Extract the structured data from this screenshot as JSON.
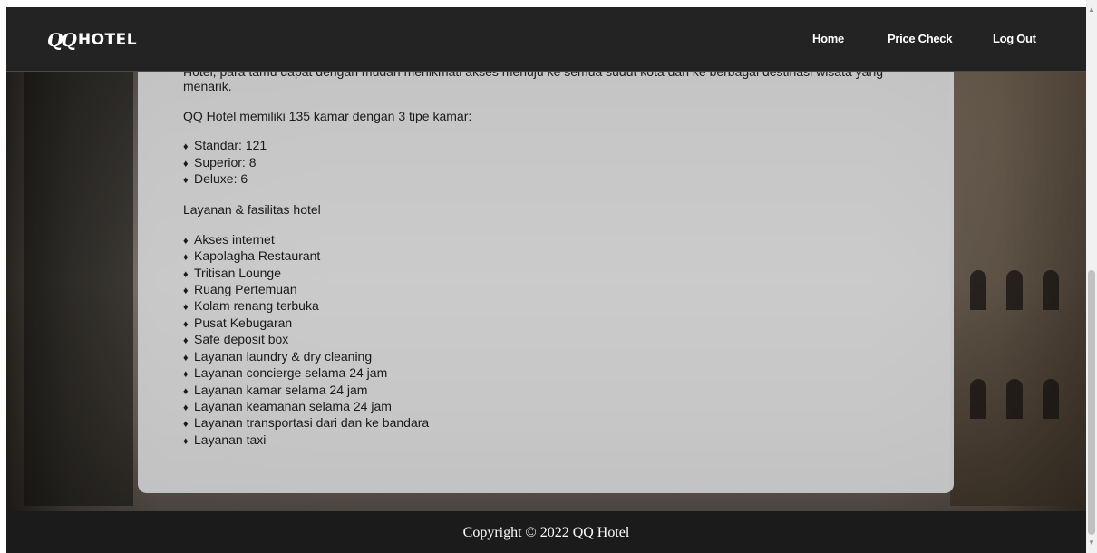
{
  "brand": {
    "mark": "QQ",
    "name": "HOTEL"
  },
  "nav": {
    "home": "Home",
    "price_check": "Price Check",
    "log_out": "Log Out"
  },
  "content": {
    "intro_cut_line1": "Hotel, para tamu dapat dengan mudah menikmati akses menuju ke semua sudut kota dan ke berbagai destinasi wisata yang",
    "intro_cut_line2": "menarik.",
    "rooms_intro": "QQ Hotel memiliki 135 kamar dengan 3 tipe kamar:",
    "room_types": [
      "Standar: 121",
      "Superior: 8",
      "Deluxe: 6"
    ],
    "facilities_heading": "Layanan & fasilitas hotel",
    "facilities": [
      "Akses internet",
      "Kapolagha Restaurant",
      "Tritisan Lounge",
      "Ruang Pertemuan",
      "Kolam renang terbuka",
      "Pusat Kebugaran",
      "Safe deposit box",
      "Layanan laundry & dry cleaning",
      "Layanan concierge selama 24 jam",
      "Layanan kamar selama 24 jam",
      "Layanan keamanan selama 24 jam",
      "Layanan transportasi dari dan ke bandara",
      "Layanan taxi"
    ],
    "bullet_glyph": "♦"
  },
  "footer": {
    "copyright": "Copyright © 2022 QQ Hotel"
  },
  "colors": {
    "navbar": "#232323",
    "footer": "#1b1b1b",
    "card": "#d6d6d8",
    "text": "#1a1a1a"
  }
}
